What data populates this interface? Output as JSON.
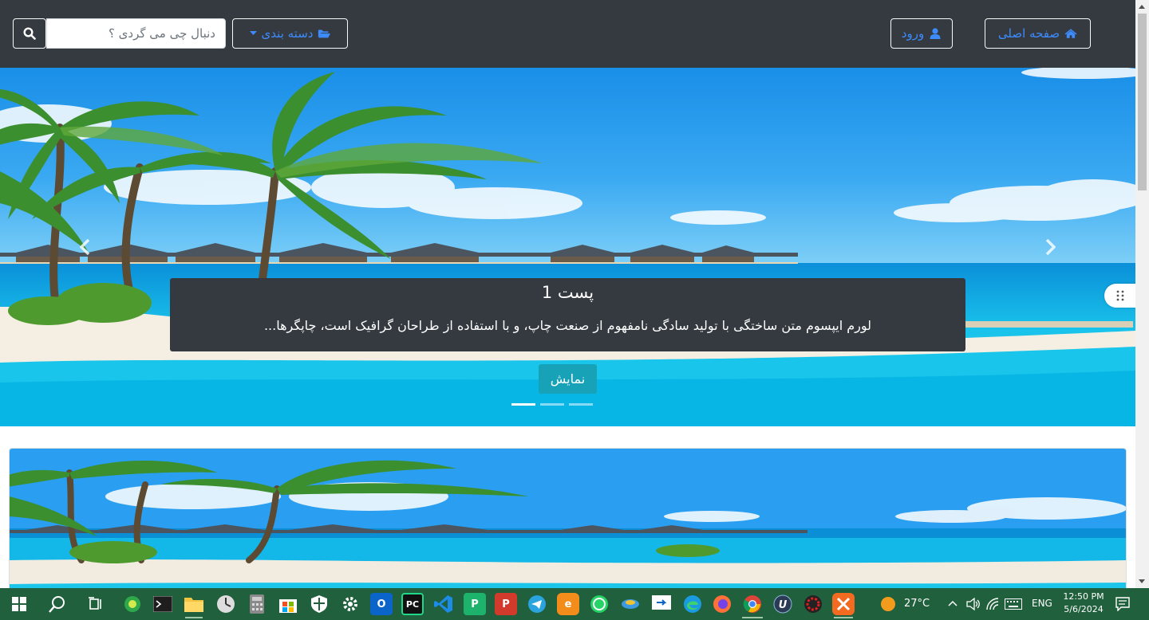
{
  "navbar": {
    "home_label": "صفحه اصلی",
    "login_label": "ورود",
    "category_label": "دسته بندی",
    "search_placeholder": "دنبال چی می گردی ؟"
  },
  "carousel": {
    "slide_title": "پست 1",
    "slide_text": "لورم ایپسوم متن ساختگی با تولید سادگی نامفهوم از صنعت چاپ، و با استفاده از طراحان گرافیک است، چاپگرها...",
    "show_button": "نمایش",
    "active_slide": 1,
    "slide_count": 3
  },
  "taskbar": {
    "weather": "27°C",
    "language": "ENG",
    "time": "12:50 PM",
    "date": "5/6/2024",
    "apps": [
      "windows-start",
      "search",
      "task-view",
      "green-app",
      "terminal",
      "file-explorer",
      "clock-app",
      "calculator",
      "microsoft-store",
      "security",
      "settings",
      "outlook-new",
      "pycharm",
      "vscode",
      "green-p-app",
      "red-p-app",
      "telegram",
      "orange-e-app",
      "whatsapp",
      "network-app",
      "remote-app",
      "edge",
      "firefox",
      "chrome",
      "blue-u-app",
      "red-gear-app",
      "xampp"
    ]
  }
}
